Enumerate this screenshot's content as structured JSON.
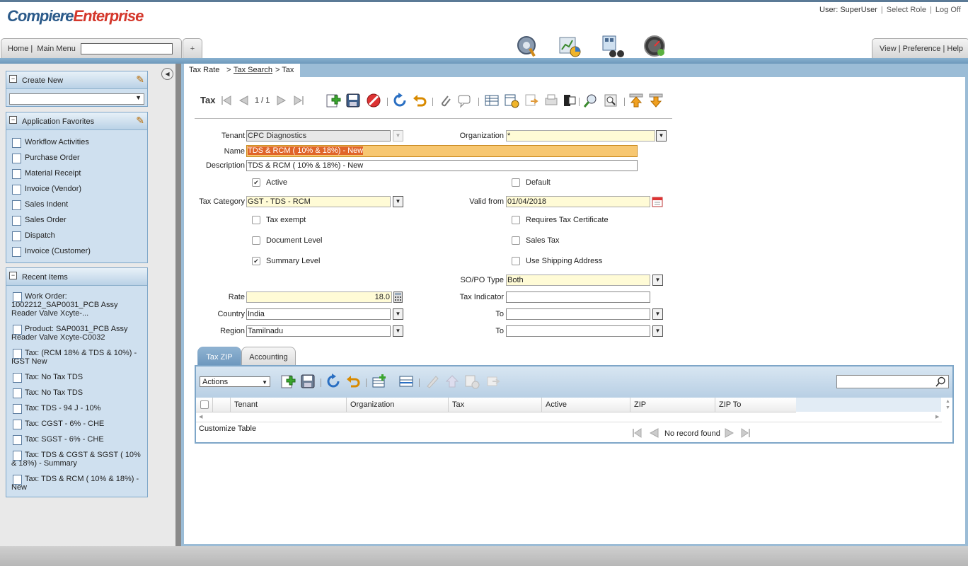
{
  "header": {
    "logo_part1": "Compiere",
    "logo_part2": "Enterprise",
    "user_label": "User: SuperUser",
    "separator": "|",
    "select_role": "Select Role",
    "logoff": "Log Off",
    "home": "Home |",
    "main_menu": "Main Menu",
    "search_value": "",
    "plus": "+",
    "right_links": "View | Preference | Help"
  },
  "left": {
    "collapse": "◀",
    "create_new": {
      "title": "Create New",
      "selected": ""
    },
    "favorites": {
      "title": "Application Favorites",
      "items": [
        "Workflow Activities",
        "Purchase Order",
        "Material Receipt",
        "Invoice (Vendor)",
        "Sales Indent",
        "Sales Order",
        "Dispatch",
        "Invoice (Customer)"
      ]
    },
    "recent": {
      "title": "Recent Items",
      "items": [
        "Work Order: 1002212_SAP0031_PCB Assy Reader Valve Xcyte-...",
        "Product: SAP0031_PCB Assy Reader Valve Xcyte-C0032",
        "Tax: (RCM 18% & TDS & 10%) - IGST New",
        "Tax: No Tax TDS",
        "Tax: No Tax TDS",
        "Tax: TDS - 94 J - 10%",
        "Tax: CGST - 6% - CHE",
        "Tax: SGST - 6% - CHE",
        "Tax: TDS & CGST & SGST ( 10% & 18%) - Summary",
        "Tax: TDS & RCM ( 10% & 18%) - New"
      ]
    }
  },
  "breadcrumb": {
    "part1": "Tax Rate",
    "sep1": ">",
    "part2": "Tax Search",
    "sep2": "> Tax"
  },
  "toolbar": {
    "title": "Tax",
    "record": "1 / 1"
  },
  "form": {
    "tenant_label": "Tenant",
    "tenant_value": "CPC Diagnostics",
    "org_label": "Organization",
    "org_value": "*",
    "name_label": "Name",
    "name_value": "TDS & RCM ( 10% & 18%) -  New",
    "desc_label": "Description",
    "desc_value": "TDS & RCM ( 10% & 18%) - New",
    "active_label": "Active",
    "default_label": "Default",
    "taxcat_label": "Tax Category",
    "taxcat_value": "GST - TDS - RCM",
    "validfrom_label": "Valid from",
    "validfrom_value": "01/04/2018",
    "taxexempt_label": "Tax exempt",
    "reqcert_label": "Requires Tax Certificate",
    "doclevel_label": "Document Level",
    "salestax_label": "Sales Tax",
    "summary_label": "Summary Level",
    "shipaddr_label": "Use Shipping Address",
    "sopo_label": "SO/PO Type",
    "sopo_value": "Both",
    "rate_label": "Rate",
    "rate_value": "18.0",
    "taxind_label": "Tax Indicator",
    "taxind_value": "",
    "country_label": "Country",
    "country_value": "India",
    "to1_label": "To",
    "to1_value": "",
    "region_label": "Region",
    "region_value": "Tamilnadu",
    "to2_label": "To",
    "to2_value": ""
  },
  "check": "✔",
  "subtabs": {
    "tab1": "Tax ZIP",
    "tab2": "Accounting"
  },
  "grid": {
    "actions": "Actions",
    "columns": [
      "Tenant",
      "Organization",
      "Tax",
      "Active",
      "ZIP",
      "ZIP To"
    ],
    "customize": "Customize Table",
    "norecord": "No record found"
  },
  "colors": {
    "accent": "#7ea6c8",
    "required": "#fffbd6",
    "selected_name": "#f7c771"
  }
}
